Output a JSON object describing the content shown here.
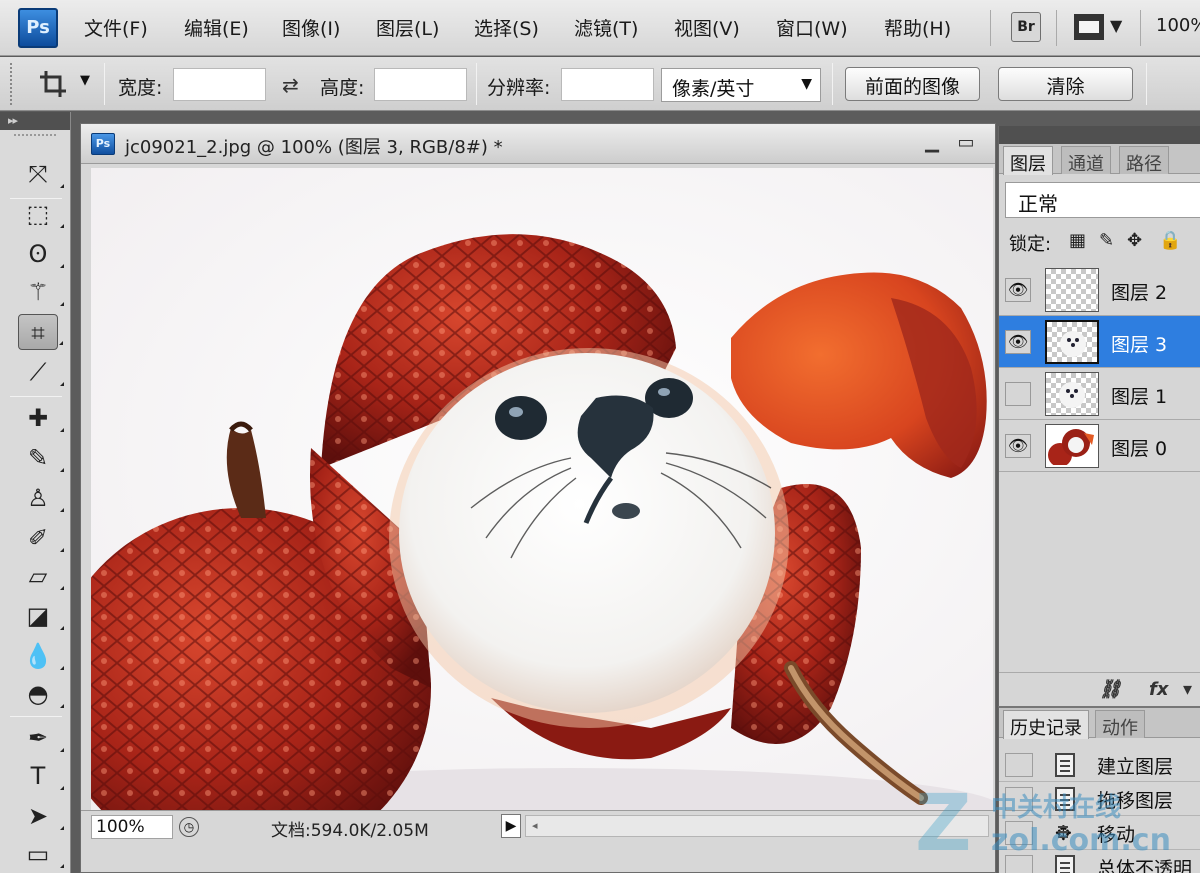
{
  "app": {
    "logo": "Ps",
    "brand_color": "#1c64c4",
    "menu": [
      "文件(F)",
      "编辑(E)",
      "图像(I)",
      "图层(L)",
      "选择(S)",
      "滤镜(T)",
      "视图(V)",
      "窗口(W)",
      "帮助(H)"
    ],
    "bridge_label": "Br",
    "zoom_level": "100%"
  },
  "options_bar": {
    "tool_icon": "crop-icon",
    "width_label": "宽度:",
    "width_value": "",
    "height_label": "高度:",
    "height_value": "",
    "resolution_label": "分辨率:",
    "resolution_value": "",
    "unit_select": "像素/英寸",
    "front_image_button": "前面的图像",
    "clear_button": "清除"
  },
  "toolbox": {
    "tools": [
      {
        "name": "move-icon",
        "glyph": "⤧"
      },
      {
        "name": "marquee-icon",
        "glyph": "⬚"
      },
      {
        "name": "lasso-icon",
        "glyph": "ʘ"
      },
      {
        "name": "magic-wand-icon",
        "glyph": "⚚"
      },
      {
        "name": "crop-icon",
        "glyph": "⌗"
      },
      {
        "name": "eyedropper-icon",
        "glyph": "⟋"
      },
      {
        "name": "healing-brush-icon",
        "glyph": "✚"
      },
      {
        "name": "brush-icon",
        "glyph": "✎"
      },
      {
        "name": "clone-stamp-icon",
        "glyph": "♙"
      },
      {
        "name": "history-brush-icon",
        "glyph": "✐"
      },
      {
        "name": "eraser-icon",
        "glyph": "▱"
      },
      {
        "name": "paint-bucket-icon",
        "glyph": "◪"
      },
      {
        "name": "blur-icon",
        "glyph": "💧"
      },
      {
        "name": "dodge-icon",
        "glyph": "◓"
      },
      {
        "name": "pen-icon",
        "glyph": "✒"
      },
      {
        "name": "type-icon",
        "glyph": "T"
      },
      {
        "name": "path-selection-icon",
        "glyph": "➤"
      },
      {
        "name": "rectangle-shape-icon",
        "glyph": "▭"
      }
    ]
  },
  "document": {
    "title": "jc09021_2.jpg @ 100% (图层 3, RGB/8#) *",
    "zoom": "100%",
    "doc_size": "文档:594.0K/2.05M"
  },
  "layers_panel": {
    "tabs": [
      "图层",
      "通道",
      "路径"
    ],
    "blend_mode": "正常",
    "lock_label": "锁定:",
    "layers": [
      {
        "name": "图层 2",
        "visible": true,
        "selected": false
      },
      {
        "name": "图层 3",
        "visible": true,
        "selected": true
      },
      {
        "name": "图层 1",
        "visible": false,
        "selected": false
      },
      {
        "name": "图层 0",
        "visible": true,
        "selected": false
      }
    ],
    "footer_icons": [
      "link-icon",
      "fx-icon"
    ]
  },
  "history_panel": {
    "tabs": [
      "历史记录",
      "动作"
    ],
    "items": [
      "建立图层",
      "拖移图层",
      "移动",
      "总体不透明"
    ]
  },
  "watermark": {
    "text": "中关村在线",
    "domain": "zol.com.cn"
  }
}
